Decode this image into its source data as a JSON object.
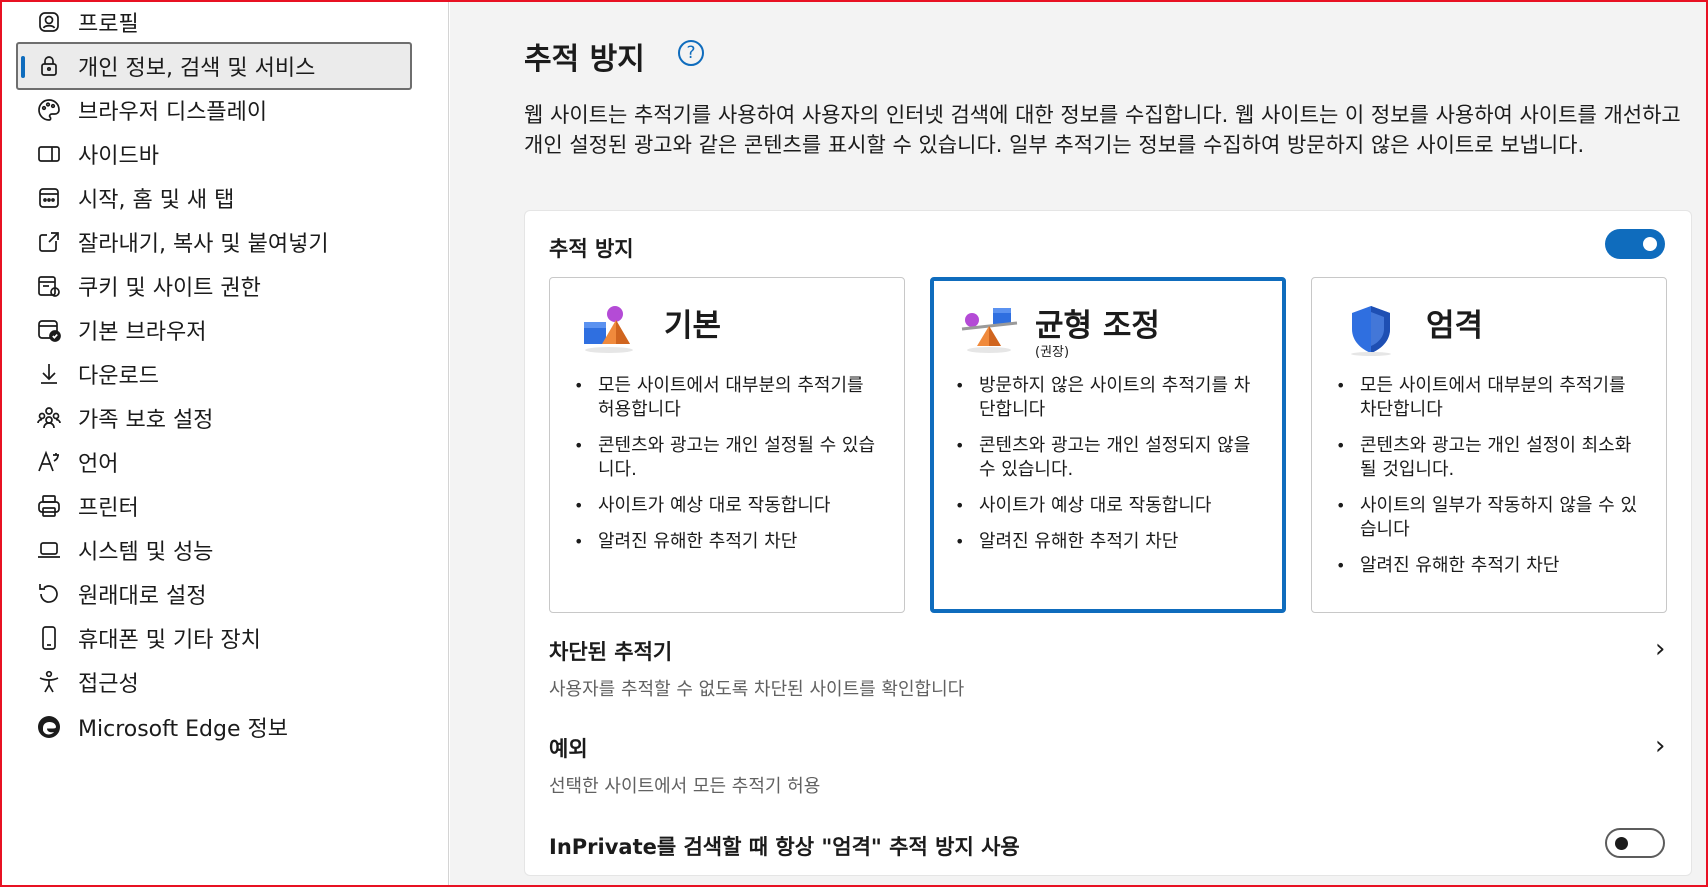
{
  "sidebar": {
    "items": [
      {
        "label": "프로필",
        "icon": "profile-icon"
      },
      {
        "label": "개인 정보, 검색 및 서비스",
        "icon": "lock-icon",
        "selected": true
      },
      {
        "label": "브라우저 디스플레이",
        "icon": "palette-icon"
      },
      {
        "label": "사이드바",
        "icon": "sidebar-icon"
      },
      {
        "label": "시작, 홈 및 새 탭",
        "icon": "home-tab-icon"
      },
      {
        "label": "잘라내기, 복사 및 붙여넣기",
        "icon": "share-icon"
      },
      {
        "label": "쿠키 및 사이트 권한",
        "icon": "cookie-settings-icon"
      },
      {
        "label": "기본 브라우저",
        "icon": "default-browser-icon"
      },
      {
        "label": "다운로드",
        "icon": "download-icon"
      },
      {
        "label": "가족 보호 설정",
        "icon": "family-icon"
      },
      {
        "label": "언어",
        "icon": "language-icon"
      },
      {
        "label": "프린터",
        "icon": "printer-icon"
      },
      {
        "label": "시스템 및 성능",
        "icon": "laptop-icon"
      },
      {
        "label": "원래대로 설정",
        "icon": "reset-icon"
      },
      {
        "label": "휴대폰 및 기타 장치",
        "icon": "phone-icon"
      },
      {
        "label": "접근성",
        "icon": "accessibility-icon"
      },
      {
        "label": "Microsoft Edge 정보",
        "icon": "edge-logo-icon"
      }
    ]
  },
  "main": {
    "title": "추적 방지",
    "help_icon": "question-circle-icon",
    "intro": "웹 사이트는 추적기를 사용하여 사용자의 인터넷 검색에 대한 정보를 수집합니다. 웹 사이트는 이 정보를 사용하여 사이트를 개선하고 개인 설정된 광고와 같은 콘텐츠를 표시할 수 있습니다. 일부 추적기는 정보를 수집하여 방문하지 않은 사이트로 보냅니다.",
    "card": {
      "title": "추적 방지",
      "toggle_on": true,
      "modes": [
        {
          "name": "기본",
          "subtitle": "",
          "illustration": "shapes-basic-icon",
          "bullets": [
            "모든 사이트에서 대부분의 추적기를 허용합니다",
            "콘텐츠와 광고는 개인 설정될 수 있습니다.",
            "사이트가 예상 대로 작동합니다",
            "알려진 유해한 추적기 차단"
          ]
        },
        {
          "name": "균형 조정",
          "subtitle": "(권장)",
          "illustration": "shapes-balance-icon",
          "selected": true,
          "bullets": [
            "방문하지 않은 사이트의 추적기를 차단합니다",
            "콘텐츠와 광고는 개인 설정되지 않을 수 있습니다.",
            "사이트가 예상 대로 작동합니다",
            "알려진 유해한 추적기 차단"
          ]
        },
        {
          "name": "엄격",
          "subtitle": "",
          "illustration": "shield-icon",
          "bullets": [
            "모든 사이트에서 대부분의 추적기를 차단합니다",
            "콘텐츠와 광고는 개인 설정이 최소화될 것입니다.",
            "사이트의 일부가 작동하지 않을 수 있습니다",
            "알려진 유해한 추적기 차단"
          ]
        }
      ],
      "blocked": {
        "title": "차단된 추적기",
        "desc": "사용자를 추적할 수 없도록 차단된 사이트를 확인합니다"
      },
      "exceptions": {
        "title": "예외",
        "desc": "선택한 사이트에서 모든 추적기 허용"
      },
      "inprivate": {
        "title": "InPrivate를 검색할 때 항상 \"엄격\" 추적 방지 사용",
        "toggle_on": false
      }
    }
  },
  "colors": {
    "accent": "#0f6cbd",
    "frame": "#e81123"
  }
}
